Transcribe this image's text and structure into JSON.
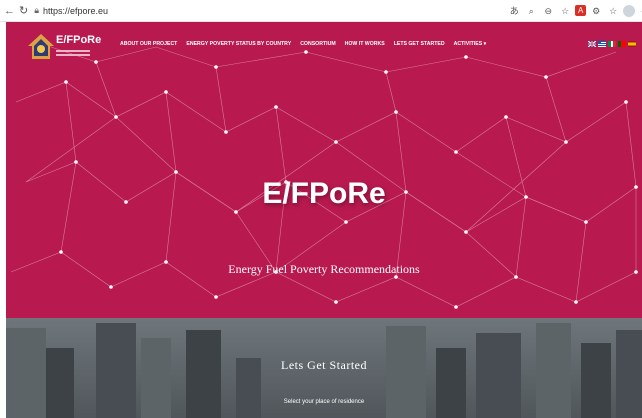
{
  "browser": {
    "url": "https://efpore.eu",
    "icons": [
      "back-icon",
      "reload-icon",
      "lock-icon",
      "translate-icon",
      "zoom-icon",
      "share-icon",
      "star-icon",
      "pdf-extension-icon",
      "extensions-icon",
      "bookmarks-icon",
      "profile-avatar",
      "more-icon"
    ]
  },
  "site": {
    "logo_text": "E/FPoRe",
    "menu": [
      "ABOUT OUR PROJECT",
      "ENERGY POVERTY STATUS BY COUNTRY",
      "CONSORTIUM",
      "HOW IT WORKS",
      "LETS GET STARTED",
      "ACTIVITIES ▾"
    ],
    "flags": [
      "uk-flag",
      "greece-flag",
      "italy-flag",
      "portugal-flag",
      "spain-flag"
    ]
  },
  "hero": {
    "title": "E/FPoRe",
    "subtitle": "Energy Fuel Poverty Recommendations",
    "background_color": "#b8194f"
  },
  "section2": {
    "title": "Lets Get Started",
    "subtitle": "Select your place of residence"
  }
}
